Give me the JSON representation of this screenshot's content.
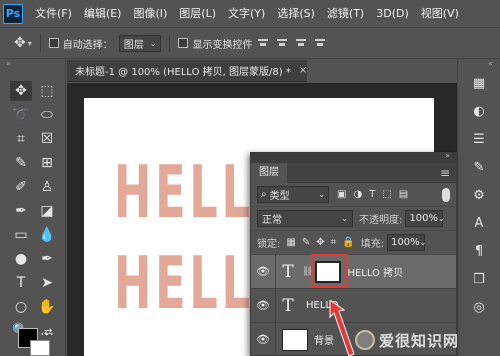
{
  "app": {
    "logo": "Ps"
  },
  "menu": [
    "文件(F)",
    "编辑(E)",
    "图像(I)",
    "图层(L)",
    "文字(Y)",
    "选择(S)",
    "滤镜(T)",
    "3D(D)",
    "视图(V)"
  ],
  "options": {
    "auto_select_label": "自动选择：",
    "auto_select_value": "图层",
    "show_transform_label": "显示变换控件"
  },
  "document": {
    "tab_title": "未标题-1 @ 100% (HELLO 拷贝, 图层蒙版/8) *",
    "close": "×",
    "canvas_text": "HELLO",
    "text_color": "#e3a898"
  },
  "layers_panel": {
    "title": "图层",
    "kind_filter": "类型",
    "blend_mode": "正常",
    "opacity_label": "不透明度:",
    "opacity_value": "100%",
    "lock_label": "锁定:",
    "fill_label": "填充:",
    "fill_value": "100%",
    "layers": [
      {
        "name": "HELLO 拷贝",
        "type_glyph": "T",
        "selected": true
      },
      {
        "name": "HELLO",
        "type_glyph": "T",
        "selected": false
      },
      {
        "name": "背景",
        "selected": false
      }
    ]
  },
  "annotation": {
    "highlight_color": "#e53935"
  },
  "watermark": {
    "text": "爱很知识网"
  }
}
